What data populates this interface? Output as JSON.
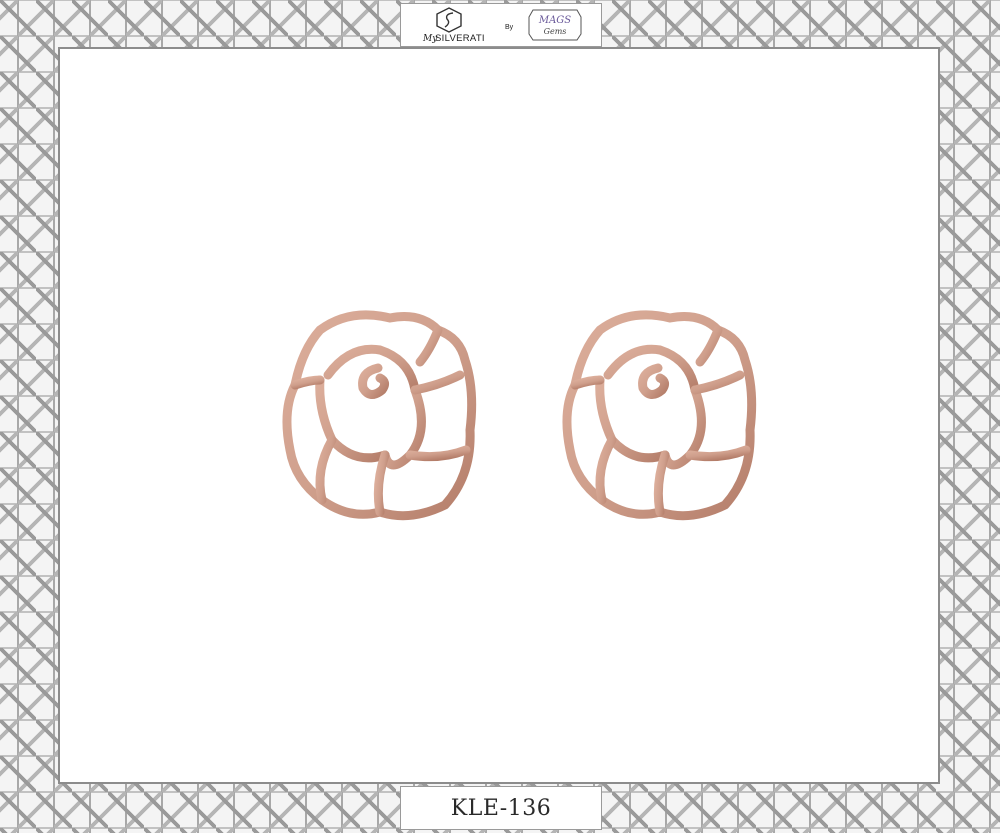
{
  "branding": {
    "brand_prefix": "My",
    "brand_name": "SILVERATI",
    "by_label": "By",
    "partner_line1": "MAGS",
    "partner_line2": "Gems"
  },
  "product": {
    "code": "KLE-136"
  },
  "colors": {
    "metal": "#cf9f8c",
    "metal_shadow": "#b47d69",
    "frame_line": "#9a9a9a"
  }
}
